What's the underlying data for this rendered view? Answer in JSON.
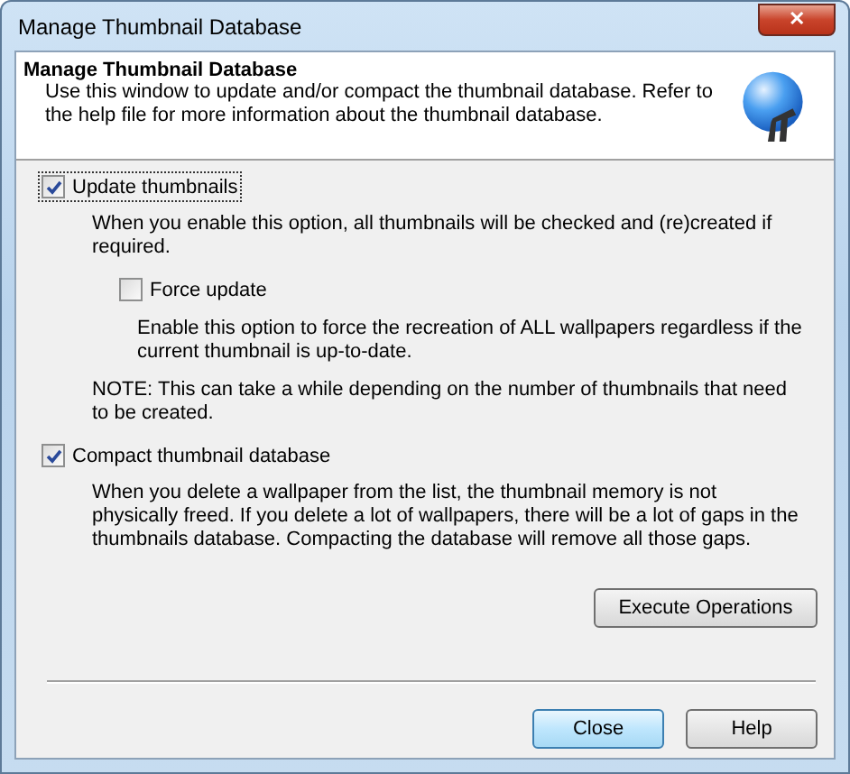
{
  "window": {
    "title": "Manage Thumbnail Database",
    "close_symbol": "✕"
  },
  "header": {
    "title": "Manage Thumbnail Database",
    "description": "Use this window to update and/or compact the thumbnail database. Refer to the help file for more information about the thumbnail database."
  },
  "options": [
    {
      "label": "Update thumbnails",
      "checked": true,
      "focused": true,
      "description": "When you enable this option, all thumbnails will be checked and (re)created if required.",
      "suboptions": [
        {
          "label": "Force update",
          "checked": false,
          "description": "Enable this option to force the recreation of ALL wallpapers regardless if the current thumbnail is up-to-date."
        }
      ],
      "note": "NOTE: This can take a while depending on the number of thumbnails that need to be created."
    },
    {
      "label": "Compact thumbnail database",
      "checked": true,
      "focused": false,
      "description": "When you delete a wallpaper from the list, the thumbnail memory is not physically freed. If you delete a lot of wallpapers, there will be a lot of gaps in the thumbnails database. Compacting the database will remove all those gaps."
    }
  ],
  "execute_button": "Execute Operations",
  "buttons": [
    {
      "label": "Close",
      "default": true
    },
    {
      "label": "Help",
      "default": false
    }
  ]
}
